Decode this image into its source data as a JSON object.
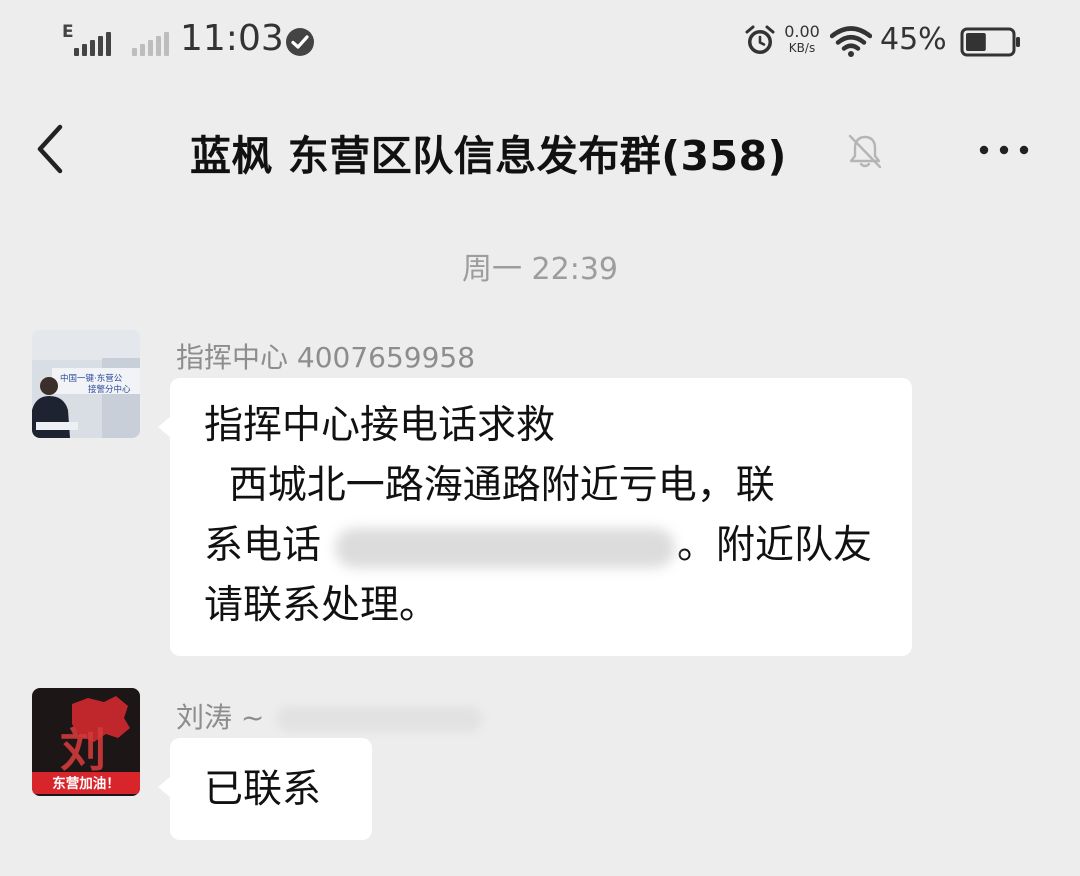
{
  "status_bar": {
    "time": "11:03",
    "network_type": "E",
    "net_speed_value": "0.00",
    "net_speed_unit": "KB/s",
    "battery_percent": "45%",
    "battery_level": 0.45
  },
  "header": {
    "title": "蓝枫 东营区队信息发布群(358)"
  },
  "chat": {
    "timestamp": "周一 22:39",
    "messages": [
      {
        "sender": "指挥中心 4007659958",
        "lines": [
          "指挥中心接电话求救",
          "  西城北一路海通路附近亏电，联",
          "系电话",
          "。附近队友",
          "请联系处理。"
        ]
      },
      {
        "sender": "刘涛 ~",
        "text": "已联系"
      }
    ]
  },
  "avatar_texts": {
    "avatar1_banner_line1": "中国一键·东营公",
    "avatar1_banner_line2": "接警分中心",
    "avatar2_badge": "东营加油！",
    "avatar2_char": "刘"
  },
  "colors": {
    "background": "#ededed",
    "bubble": "#ffffff",
    "secondary_text": "#8d8d8d"
  }
}
